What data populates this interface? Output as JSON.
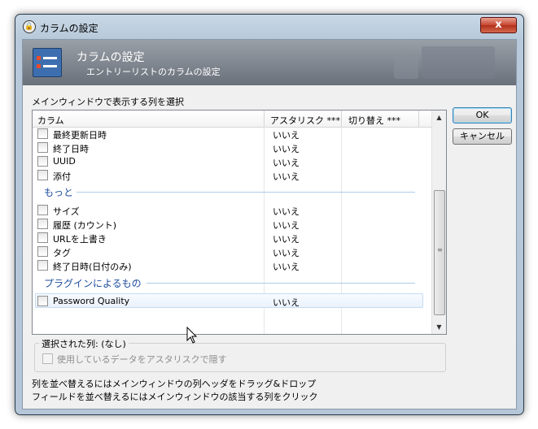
{
  "window": {
    "title": "カラムの設定",
    "close_glyph": "x"
  },
  "banner": {
    "title": "カラムの設定",
    "subtitle": "エントリーリストのカラムの設定"
  },
  "select_label": "メインウィンドウで表示する列を選択",
  "list": {
    "headers": [
      "カラム",
      "アスタリスク ***",
      "切り替え ***"
    ],
    "rows_top": [
      {
        "label": "最終更新日時",
        "value": "いいえ"
      },
      {
        "label": "終了日時",
        "value": "いいえ"
      },
      {
        "label": "UUID",
        "value": "いいえ"
      },
      {
        "label": "添付",
        "value": "いいえ"
      }
    ],
    "group_more": "もっと",
    "rows_more": [
      {
        "label": "サイズ",
        "value": "いいえ"
      },
      {
        "label": "履歴 (カウント)",
        "value": "いいえ"
      },
      {
        "label": "URLを上書き",
        "value": "いいえ"
      },
      {
        "label": "タグ",
        "value": "いいえ"
      },
      {
        "label": "終了日時(日付のみ)",
        "value": "いいえ"
      }
    ],
    "group_plugin": "プラグインによるもの",
    "rows_plugin": [
      {
        "label": "Password Quality",
        "value": "いいえ"
      }
    ]
  },
  "buttons": {
    "ok": "OK",
    "cancel": "キャンセル"
  },
  "selected": {
    "title": "選択された列: (なし)",
    "hide_label": "使用しているデータをアスタリスクで隠す"
  },
  "help": {
    "line1": "列を並べ替えるにはメインウィンドウの列ヘッダをドラッグ&ドロップ",
    "line2": "フィールドを並べ替えるにはメインウィンドウの該当する列をクリック"
  }
}
